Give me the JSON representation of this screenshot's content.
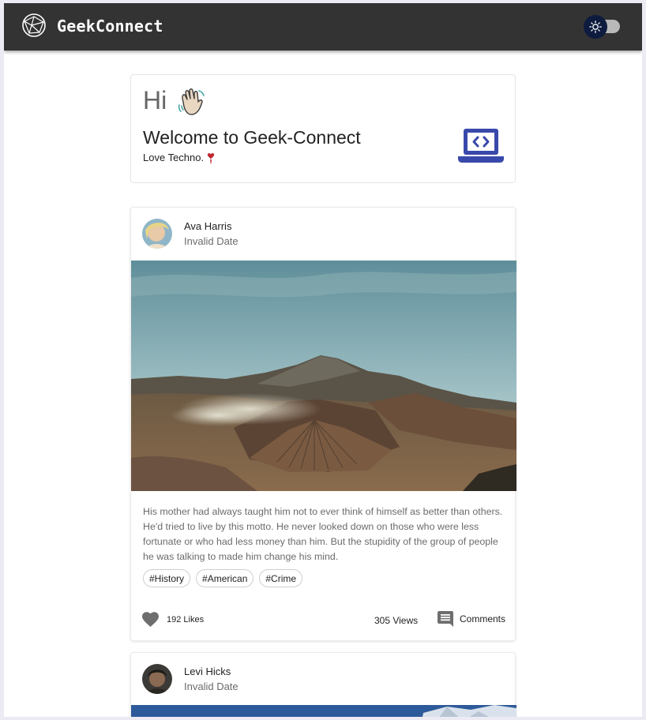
{
  "app": {
    "brand": "GeekConnect",
    "logo_icon": "globe-network-icon",
    "theme_toggle_icon": "sun-icon"
  },
  "welcome": {
    "greeting": "Hi",
    "greeting_emoji": "waving-hand-icon",
    "title": "Welcome to Geek-Connect",
    "tagline": "Love Techno.",
    "tagline_icon": "heart-exclamation-icon",
    "illustration_icon": "laptop-code-icon",
    "accent_color": "#3949ab"
  },
  "posts": [
    {
      "author": "Ava Harris",
      "date": "Invalid Date",
      "image": "volcano-landscape",
      "text": "His mother had always taught him not to ever think of himself as better than others. He'd tried to live by this motto. He never looked down on those who were less fortunate or who had less money than him. But the stupidity of the group of people he was talking to made him change his mind.",
      "tags": [
        "#History",
        "#American",
        "#Crime"
      ],
      "likes": "192 Likes",
      "views": "305 Views",
      "comments_label": "Comments"
    },
    {
      "author": "Levi Hicks",
      "date": "Invalid Date",
      "image": "mountain-sky"
    }
  ]
}
